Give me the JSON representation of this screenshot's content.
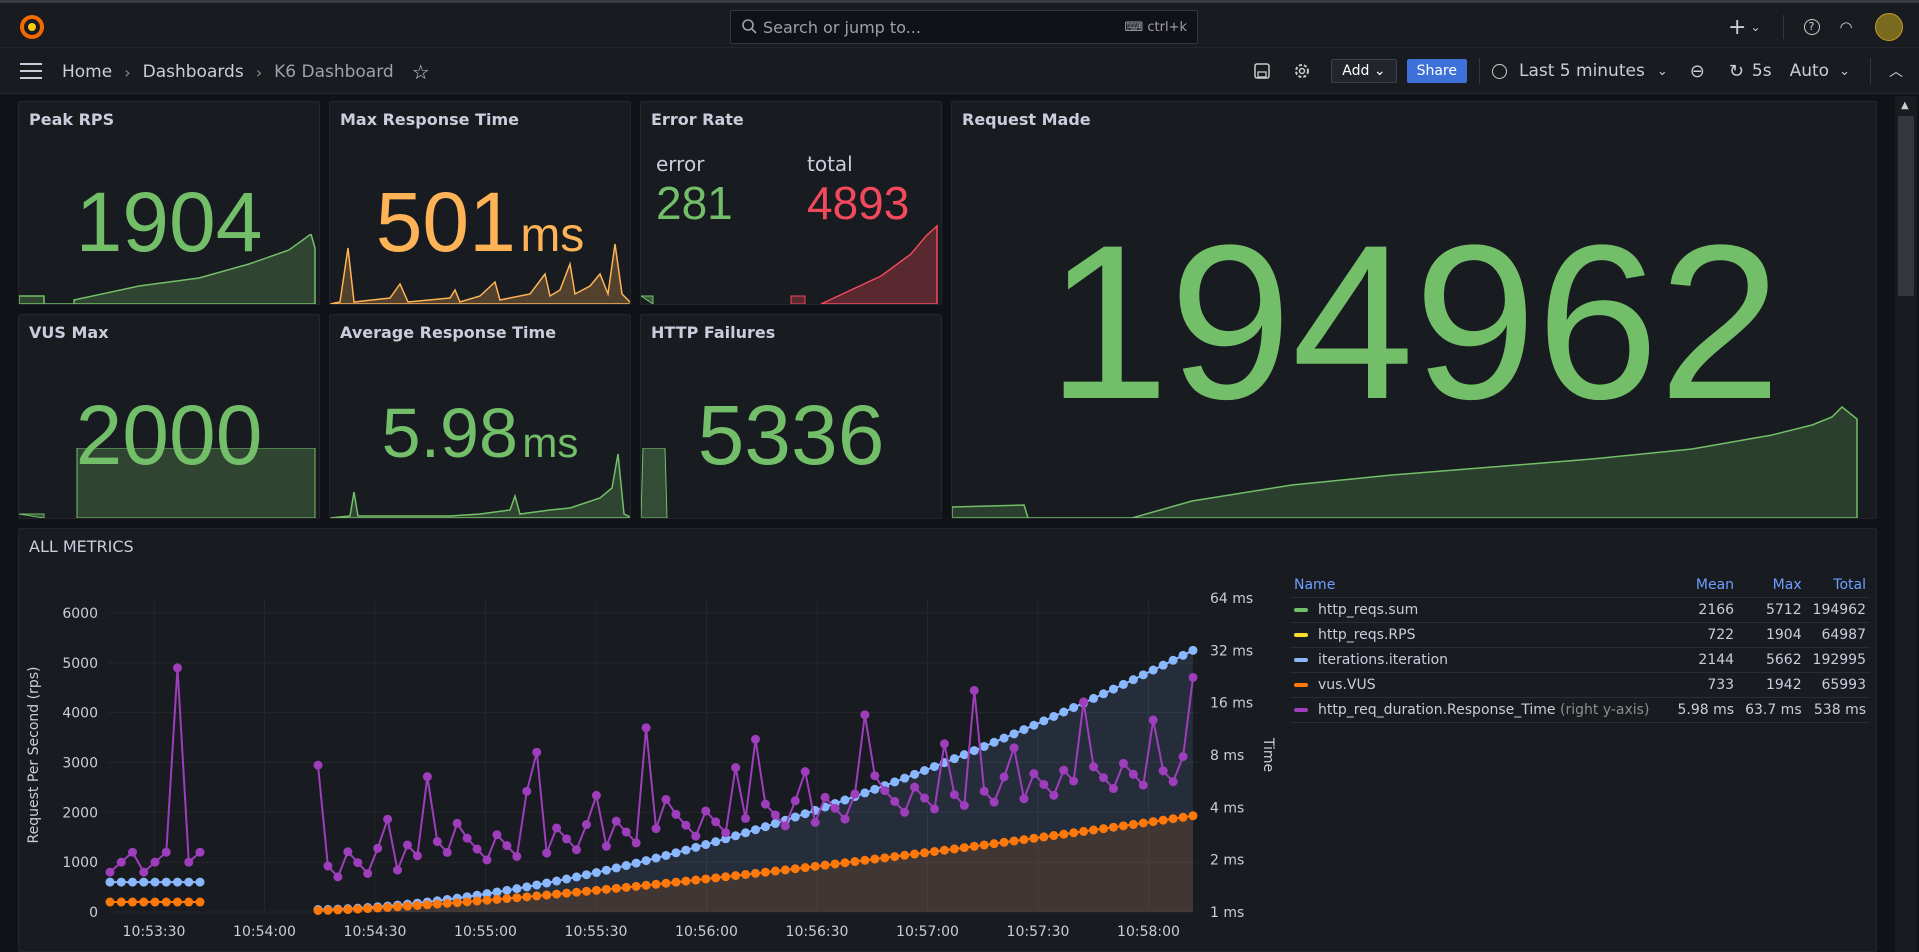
{
  "colors": {
    "green": "#73bf69",
    "orange": "#ffb357",
    "red": "#f2495c",
    "blue": "#8ab8ff",
    "yellow": "#fade2a",
    "purple": "#9e3ebd",
    "vus": "#ff780a"
  },
  "topbar": {
    "search_placeholder": "Search or jump to...",
    "search_shortcut": "ctrl+k"
  },
  "breadcrumb": {
    "home": "Home",
    "dashboards": "Dashboards",
    "current": "K6 Dashboard"
  },
  "toolbar": {
    "add_label": "Add",
    "share_label": "Share",
    "time_range": "Last 5 minutes",
    "refresh_interval": "5s",
    "refresh_mode": "Auto"
  },
  "panels": {
    "peak_rps": {
      "title": "Peak RPS",
      "value": "1904"
    },
    "max_response": {
      "title": "Max Response Time",
      "value": "501",
      "unit": "ms"
    },
    "error_rate": {
      "title": "Error Rate",
      "error_label": "error",
      "error_value": "281",
      "total_label": "total",
      "total_value": "4893"
    },
    "request_made": {
      "title": "Request Made",
      "value": "194962"
    },
    "vus_max": {
      "title": "VUS Max",
      "value": "2000"
    },
    "avg_response": {
      "title": "Average Response Time",
      "value": "5.98",
      "unit": "ms"
    },
    "http_failures": {
      "title": "HTTP Failures",
      "value": "5336"
    },
    "all_metrics": {
      "title": "ALL METRICS"
    }
  },
  "chart_data": {
    "type": "line",
    "x_ticks": [
      "10:53:30",
      "10:54:00",
      "10:54:30",
      "10:55:00",
      "10:55:30",
      "10:56:00",
      "10:56:30",
      "10:57:00",
      "10:57:30",
      "10:58:00"
    ],
    "ylabel": "Request Per Second (rps)",
    "y_ticks": [
      "0",
      "1000",
      "2000",
      "3000",
      "4000",
      "5000",
      "6000"
    ],
    "ylim": [
      0,
      6300
    ],
    "y2label": "Time",
    "y2_ticks": [
      "1 ms",
      "2 ms",
      "4 ms",
      "8 ms",
      "16 ms",
      "32 ms",
      "64 ms"
    ],
    "y2_scale": "log2",
    "legend_columns": [
      "Name",
      "Mean",
      "Max",
      "Total"
    ],
    "series": [
      {
        "name": "http_reqs.sum",
        "mean": "2166",
        "max": "5712",
        "total": "194962",
        "color": "#73bf69"
      },
      {
        "name": "http_reqs.RPS",
        "mean": "722",
        "max": "1904",
        "total": "64987",
        "color": "#fade2a"
      },
      {
        "name": "iterations.iteration",
        "mean": "2144",
        "max": "5662",
        "total": "192995",
        "color": "#8ab8ff"
      },
      {
        "name": "vus.VUS",
        "mean": "733",
        "max": "1942",
        "total": "65993",
        "color": "#ff780a"
      },
      {
        "name": "http_req_duration.Response_Time",
        "suffix": "(right y-axis)",
        "mean": "5.98 ms",
        "max": "63.7 ms",
        "total": "538 ms",
        "color": "#9e3ebd"
      }
    ]
  }
}
